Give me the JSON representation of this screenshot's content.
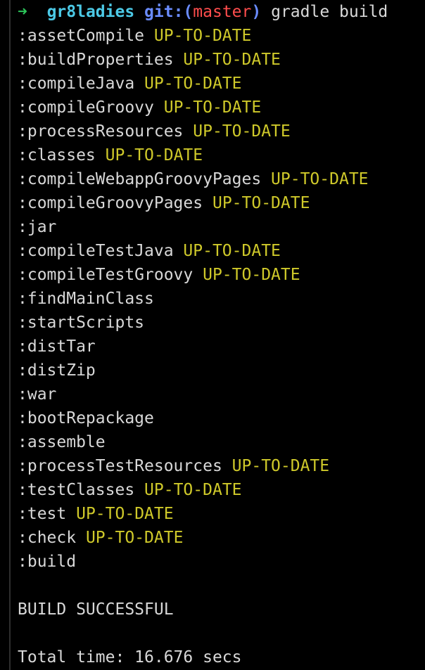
{
  "colors": {
    "background": "#000000",
    "text": "#d8d8d8",
    "status": "#cfc92a",
    "prompt_arrow": "#2cc55a",
    "prompt_dir": "#4cc9e6",
    "prompt_git": "#6a8cff",
    "prompt_branch": "#ff4d4d"
  },
  "prompt": {
    "arrow_icon": "right-arrow-icon",
    "arrow": "➜",
    "directory": "gr8ladies",
    "git_label": "git:(",
    "branch": "master",
    "git_close": ")",
    "command": "gradle build"
  },
  "truncated_top_line": "",
  "tasks": [
    {
      "name": ":assetCompile",
      "status": "UP-TO-DATE"
    },
    {
      "name": ":buildProperties",
      "status": "UP-TO-DATE"
    },
    {
      "name": ":compileJava",
      "status": "UP-TO-DATE"
    },
    {
      "name": ":compileGroovy",
      "status": "UP-TO-DATE"
    },
    {
      "name": ":processResources",
      "status": "UP-TO-DATE"
    },
    {
      "name": ":classes",
      "status": "UP-TO-DATE"
    },
    {
      "name": ":compileWebappGroovyPages",
      "status": "UP-TO-DATE"
    },
    {
      "name": ":compileGroovyPages",
      "status": "UP-TO-DATE"
    },
    {
      "name": ":jar",
      "status": ""
    },
    {
      "name": ":compileTestJava",
      "status": "UP-TO-DATE"
    },
    {
      "name": ":compileTestGroovy",
      "status": "UP-TO-DATE"
    },
    {
      "name": ":findMainClass",
      "status": ""
    },
    {
      "name": ":startScripts",
      "status": ""
    },
    {
      "name": ":distTar",
      "status": ""
    },
    {
      "name": ":distZip",
      "status": ""
    },
    {
      "name": ":war",
      "status": ""
    },
    {
      "name": ":bootRepackage",
      "status": ""
    },
    {
      "name": ":assemble",
      "status": ""
    },
    {
      "name": ":processTestResources",
      "status": "UP-TO-DATE"
    },
    {
      "name": ":testClasses",
      "status": "UP-TO-DATE"
    },
    {
      "name": ":test",
      "status": "UP-TO-DATE"
    },
    {
      "name": ":check",
      "status": "UP-TO-DATE"
    },
    {
      "name": ":build",
      "status": ""
    }
  ],
  "result": "BUILD SUCCESSFUL",
  "total_time": "Total time: 16.676 secs"
}
